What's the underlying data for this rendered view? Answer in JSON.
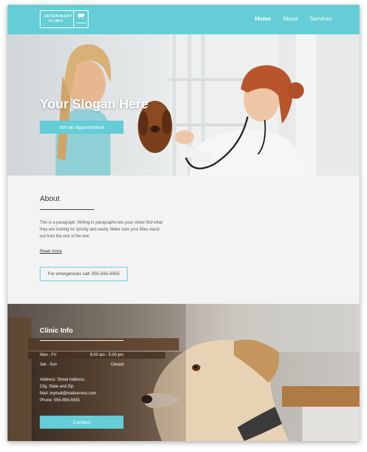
{
  "header": {
    "logo": {
      "line1": "VETERINARY",
      "line2": "CLINIC"
    },
    "nav": [
      {
        "label": "Home"
      },
      {
        "label": "About"
      },
      {
        "label": "Services"
      }
    ]
  },
  "hero": {
    "title": "Your Slogan Here",
    "button_label": "Set an Appointment"
  },
  "about": {
    "title": "About",
    "paragraph": "This is a paragraph. Writing in paragraphs lets your visitor find what they are looking for quickly and easily. Make sure your titles stand out from the rest of the text.",
    "read_more": "Read more",
    "emergency": "For emergencies call: 555-555-5555"
  },
  "clinic": {
    "title": "Clinic Info",
    "hours": [
      {
        "day": "Mon - Fri",
        "time": "9:00 am - 5:00 pm"
      },
      {
        "day": "Sat - Sun",
        "time": "Closed"
      }
    ],
    "address_line1": "Address: Street Address,",
    "address_line2": "City, State and Zip",
    "mail": "Mail: mymail@mailservice.com",
    "phone": "Phone: 555-555-5555",
    "button_label": "Contact"
  },
  "colors": {
    "accent": "#64cdd5"
  }
}
